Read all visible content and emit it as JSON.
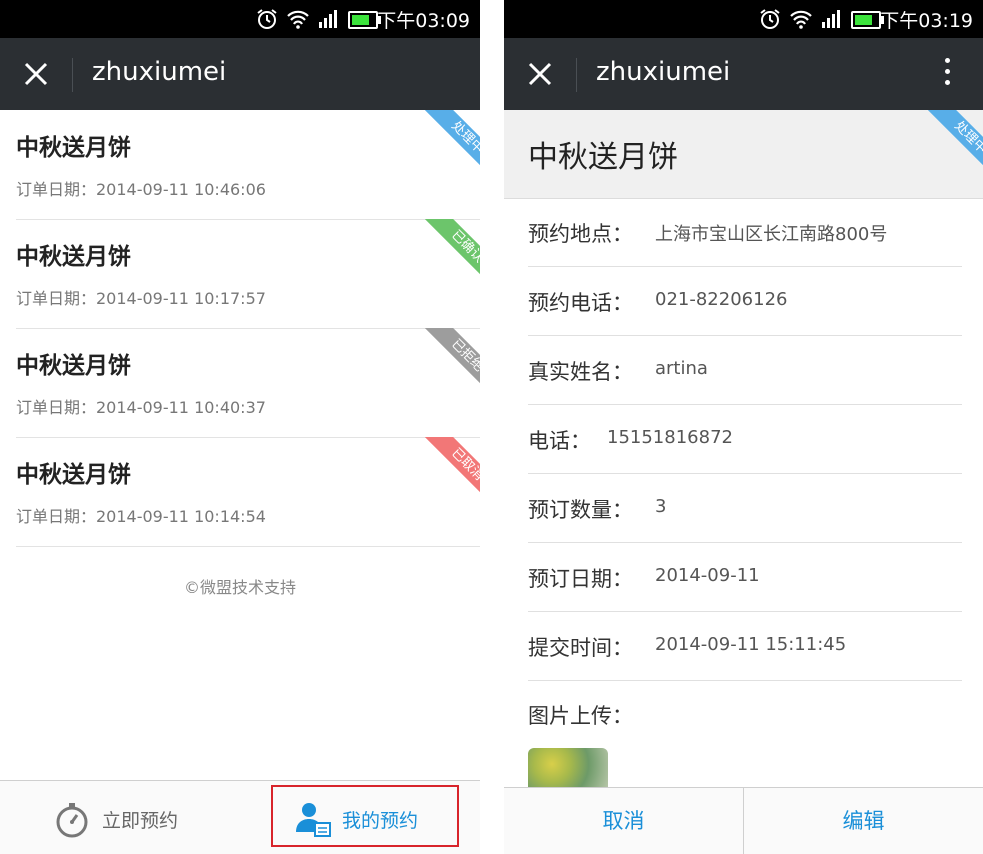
{
  "colors": {
    "processing": "#58aee8",
    "confirmed": "#6cc56b",
    "rejected": "#9d9d9d",
    "cancelled": "#f27777",
    "accent": "#1a8fd8",
    "highlight": "#d8242b"
  },
  "left": {
    "status_time": "下午03:09",
    "title": "zhuxiumei",
    "orders": [
      {
        "title": "中秋送月饼",
        "date": "订单日期：2014-09-11 10:46:06",
        "status": "处理中",
        "status_color": "#58aee8"
      },
      {
        "title": "中秋送月饼",
        "date": "订单日期：2014-09-11 10:17:57",
        "status": "已确认",
        "status_color": "#6cc56b"
      },
      {
        "title": "中秋送月饼",
        "date": "订单日期：2014-09-11 10:40:37",
        "status": "已拒绝",
        "status_color": "#9d9d9d"
      },
      {
        "title": "中秋送月饼",
        "date": "订单日期：2014-09-11 10:14:54",
        "status": "已取消",
        "status_color": "#f27777"
      }
    ],
    "support": "©微盟技术支持",
    "nav": {
      "book": "立即预约",
      "mine": "我的预约"
    }
  },
  "right": {
    "status_time": "下午03:19",
    "title": "zhuxiumei",
    "header_title": "中秋送月饼",
    "header_status": "处理中",
    "fields": [
      {
        "label": "预约地点：",
        "value": "上海市宝山区长江南路800号"
      },
      {
        "label": "预约电话：",
        "value": "021-82206126"
      },
      {
        "label": "真实姓名：",
        "value": "artina"
      },
      {
        "label": "电话：",
        "value": "15151816872"
      },
      {
        "label": "预订数量：",
        "value": "3"
      },
      {
        "label": "预订日期：",
        "value": "2014-09-11"
      },
      {
        "label": "提交时间：",
        "value": "2014-09-11 15:11:45"
      }
    ],
    "upload_label": "图片上传：",
    "actions": {
      "cancel": "取消",
      "edit": "编辑"
    }
  }
}
